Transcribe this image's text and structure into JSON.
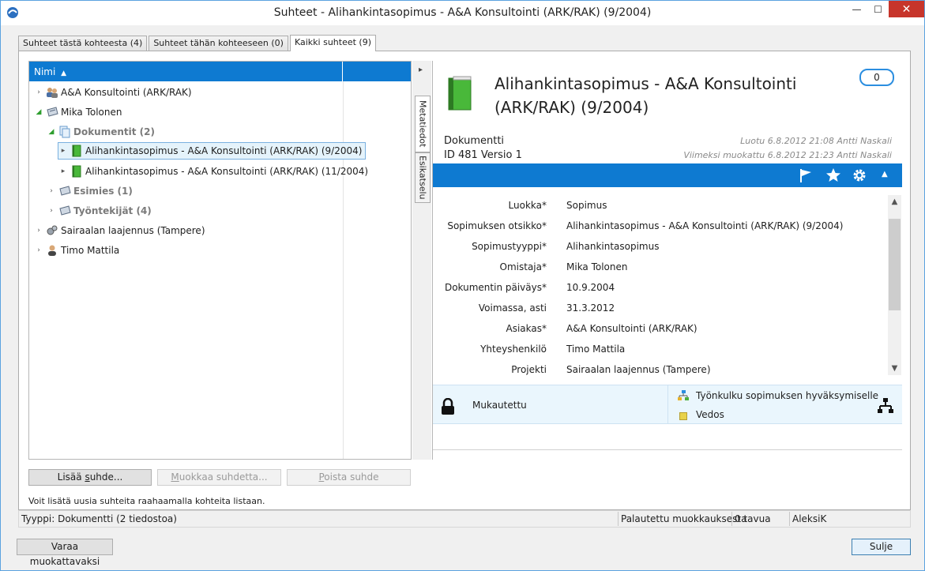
{
  "window": {
    "title": "Suhteet - Alihankintasopimus - A&A Konsultointi (ARK/RAK) (9/2004)",
    "close_symbol": "✕",
    "minimize_symbol": "—",
    "maximize_symbol": "☐"
  },
  "tabs": [
    {
      "label": "Suhteet tästä kohteesta (4)"
    },
    {
      "label": "Suhteet tähän kohteeseen (0)"
    },
    {
      "label": "Kaikki suhteet (9)"
    }
  ],
  "tree": {
    "header": "Nimi",
    "sort_indicator": "▲",
    "items": [
      {
        "label": "A&A Konsultointi (ARK/RAK)",
        "icon": "people-icon",
        "expander": "›"
      },
      {
        "label": "Mika Tolonen",
        "icon": "card-icon",
        "expander": "◢"
      },
      {
        "label": "Dokumentit (2)",
        "icon": "documents-icon",
        "expander": "◢"
      },
      {
        "label": "Alihankintasopimus - A&A Konsultointi (ARK/RAK) (9/2004)",
        "icon": "green-book-icon",
        "expander": "▸"
      },
      {
        "label": "Alihankintasopimus - A&A Konsultointi (ARK/RAK) (11/2004)",
        "icon": "green-book-icon",
        "expander": "▸"
      },
      {
        "label": "Esimies (1)",
        "icon": "card-icon",
        "expander": "›"
      },
      {
        "label": "Työntekijät (4)",
        "icon": "card-icon",
        "expander": "›"
      },
      {
        "label": "Sairaalan laajennus (Tampere)",
        "icon": "gears-icon",
        "expander": "›"
      },
      {
        "label": "Timo Mattila",
        "icon": "person-icon",
        "expander": "›"
      }
    ]
  },
  "side_tabs": {
    "collapse": "▸",
    "metadata": "Metatiedot",
    "preview": "Esikatselu"
  },
  "detail": {
    "title": "Alihankintasopimus - A&A Konsultointi (ARK/RAK) (9/2004)",
    "comments_count": "0",
    "type": "Dokumentti",
    "id_version": "ID 481  Versio 1",
    "created": "Luotu 6.8.2012 21:08 Antti Naskali",
    "modified": "Viimeksi muokattu 6.8.2012 21:23 Antti Naskali",
    "toolbar_collapse": "▲",
    "properties": [
      {
        "label": "Luokka*",
        "value": "Sopimus"
      },
      {
        "label": "Sopimuksen otsikko*",
        "value": "Alihankintasopimus - A&A Konsultointi (ARK/RAK) (9/2004)"
      },
      {
        "label": "Sopimustyyppi*",
        "value": "Alihankintasopimus"
      },
      {
        "label": "Omistaja*",
        "value": "Mika Tolonen"
      },
      {
        "label": "Dokumentin päiväys*",
        "value": "10.9.2004"
      },
      {
        "label": "Voimassa, asti",
        "value": "31.3.2012"
      },
      {
        "label": "Asiakas*",
        "value": "A&A Konsultointi (ARK/RAK)"
      },
      {
        "label": "Yhteyshenkilö",
        "value": "Timo Mattila"
      },
      {
        "label": "Projekti",
        "value": "Sairaalan laajennus (Tampere)"
      }
    ],
    "permissions": "Mukautettu",
    "workflow": "Työnkulku sopimuksen hyväksymiselle",
    "state": "Vedos"
  },
  "buttons": {
    "add_prefix": "Lisää ",
    "add_underlined": "s",
    "add_suffix": "uhde...",
    "edit_underlined": "M",
    "edit_suffix": "uokkaa suhdetta...",
    "delete_underlined": "P",
    "delete_suffix": "oista suhde",
    "reserve": "Varaa muokattavaksi",
    "close": "Sulje"
  },
  "hint": "Voit lisätä uusia suhteita raahaamalla kohteita listaan.",
  "statusbar": {
    "type": "Tyyppi: Dokumentti (2 tiedostoa)",
    "restored": "Palautettu muokkauksesta",
    "size": "0 tavua",
    "user": "AleksiK"
  }
}
